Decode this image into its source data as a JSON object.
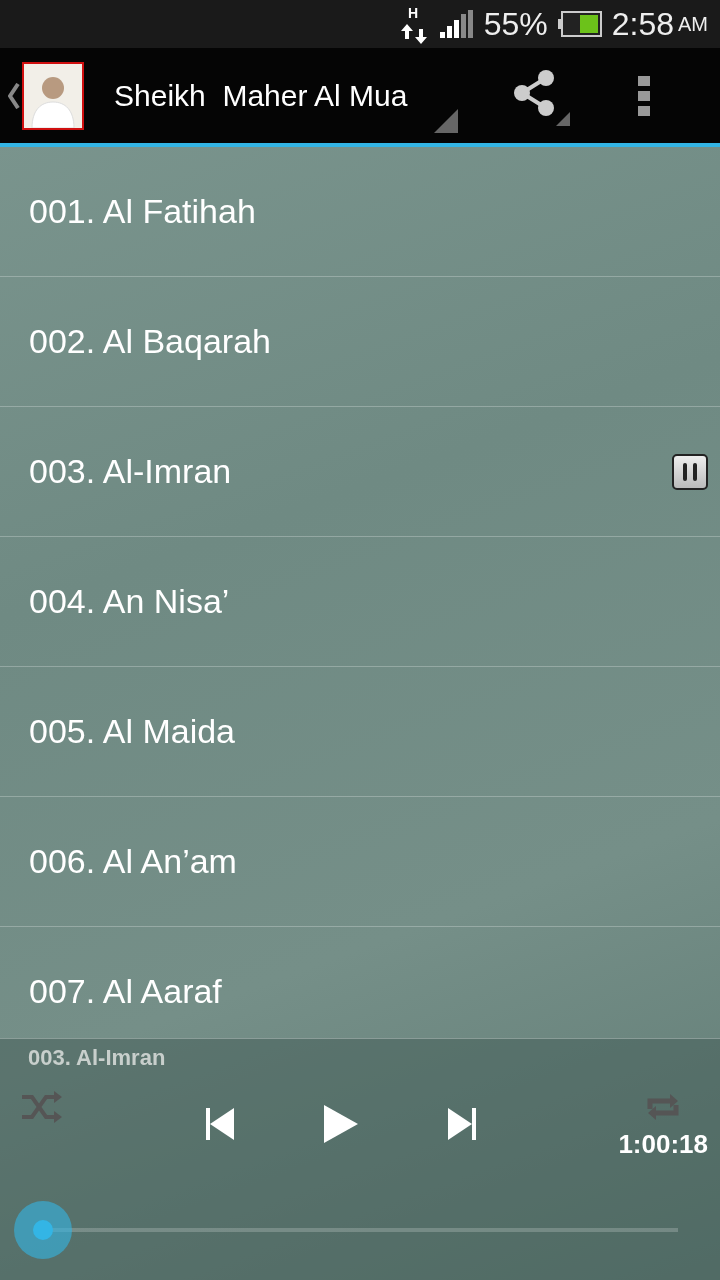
{
  "status_bar": {
    "network": "H",
    "battery": "55%",
    "time": "2:58",
    "ampm": "AM"
  },
  "action_bar": {
    "title": "Sheikh  Maher Al Mua"
  },
  "tracks": [
    {
      "title": "001. Al Fatihah",
      "playing": false
    },
    {
      "title": "002. Al Baqarah",
      "playing": false
    },
    {
      "title": "003. Al-Imran",
      "playing": true
    },
    {
      "title": "004. An Nisa’",
      "playing": false
    },
    {
      "title": "005. Al Maida",
      "playing": false
    },
    {
      "title": "006. Al An’am",
      "playing": false
    },
    {
      "title": "007. Al Aaraf",
      "playing": false
    }
  ],
  "player": {
    "now_playing": "003. Al-Imran",
    "shuffle": false,
    "repeat": false,
    "duration": "1:00:18"
  }
}
